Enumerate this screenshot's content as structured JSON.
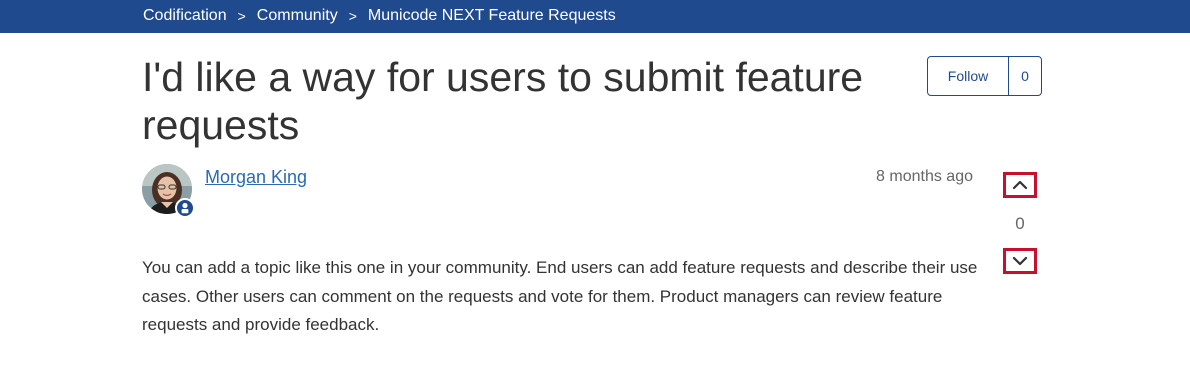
{
  "breadcrumb": {
    "items": [
      "Codification",
      "Community",
      "Municode NEXT Feature Requests"
    ],
    "separator": ">"
  },
  "topic": {
    "title": "I'd like a way for users to submit feature requests",
    "author": "Morgan King",
    "posted": "8 months ago",
    "body": "You can add a topic like this one in your community. End users can add feature requests and describe their use cases. Other users can comment on the requests and vote for them. Product managers can review feature requests and provide feedback."
  },
  "follow": {
    "label": "Follow",
    "count": "0"
  },
  "votes": {
    "count": "0",
    "upvote_icon": "chevron-up-icon",
    "downvote_icon": "chevron-down-icon"
  },
  "colors": {
    "brand": "#1f4a8e",
    "vote_highlight": "#c8102e",
    "link": "#2a6ab5"
  }
}
